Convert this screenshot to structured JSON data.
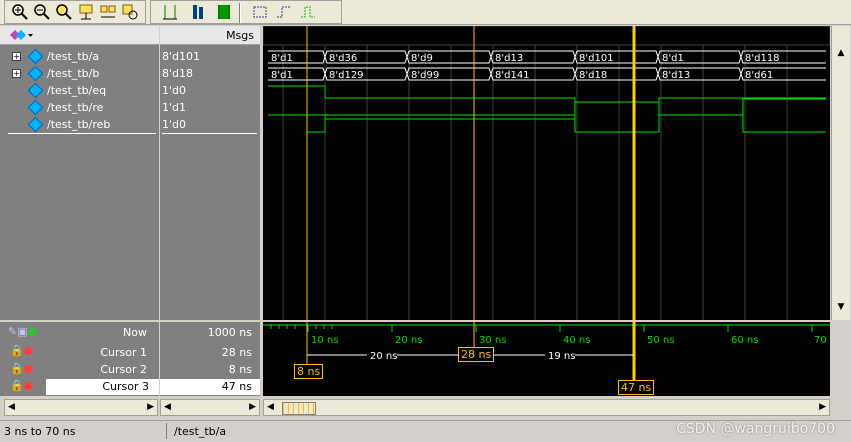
{
  "toolbar": {
    "icons": [
      "zoom-in-icon",
      "zoom-out-icon",
      "zoom-full-icon",
      "zoom-cursor-icon",
      "zoom-prev-icon",
      "zoom-area-icon",
      "wave-display-icon",
      "wave-bar-icon",
      "wave-fill-icon",
      "wave-step-icon",
      "wave-edge-icon",
      "wave-pulse-icon"
    ]
  },
  "header": {
    "msgs_label": "Msgs"
  },
  "signals": [
    {
      "name": "/test_tb/a",
      "value": "8'd101",
      "expandable": true
    },
    {
      "name": "/test_tb/b",
      "value": "8'd18",
      "expandable": true
    },
    {
      "name": "/test_tb/eq",
      "value": "1'd0",
      "expandable": false
    },
    {
      "name": "/test_tb/re",
      "value": "1'd1",
      "expandable": false
    },
    {
      "name": "/test_tb/reb",
      "value": "1'd0",
      "expandable": false
    }
  ],
  "bus_a_labels": [
    "8'd1",
    "8'd36",
    "8'd9",
    "8'd13",
    "8'd101",
    "8'd1",
    "8'd118"
  ],
  "bus_b_labels": [
    "8'd1",
    "8'd129",
    "8'd99",
    "8'd141",
    "8'd18",
    "8'd13",
    "8'd61"
  ],
  "bottom": {
    "now_label": "Now",
    "now_value": "1000 ns",
    "cursor1_label": "Cursor 1",
    "cursor1_value": "28 ns",
    "cursor2_label": "Cursor 2",
    "cursor2_value": "8 ns",
    "cursor3_label": "Cursor 3",
    "cursor3_value": "47 ns"
  },
  "timeline": {
    "ticks": [
      "10 ns",
      "20 ns",
      "30 ns",
      "40 ns",
      "50 ns",
      "60 ns",
      "70"
    ],
    "delta_1": "20 ns",
    "delta_2": "19 ns",
    "cursor1_tag": "28 ns",
    "cursor2_tag": "8 ns",
    "cursor3_tag": "47 ns"
  },
  "status": {
    "range": "3 ns to 70 ns",
    "selected": "/test_tb/a"
  },
  "watermark": "CSDN @wangruibo700",
  "colors": {
    "wave_green": "#00e000",
    "cursor_yellow": "#ffc000",
    "cursor_active": "#ffd000",
    "grid": "#404040"
  }
}
